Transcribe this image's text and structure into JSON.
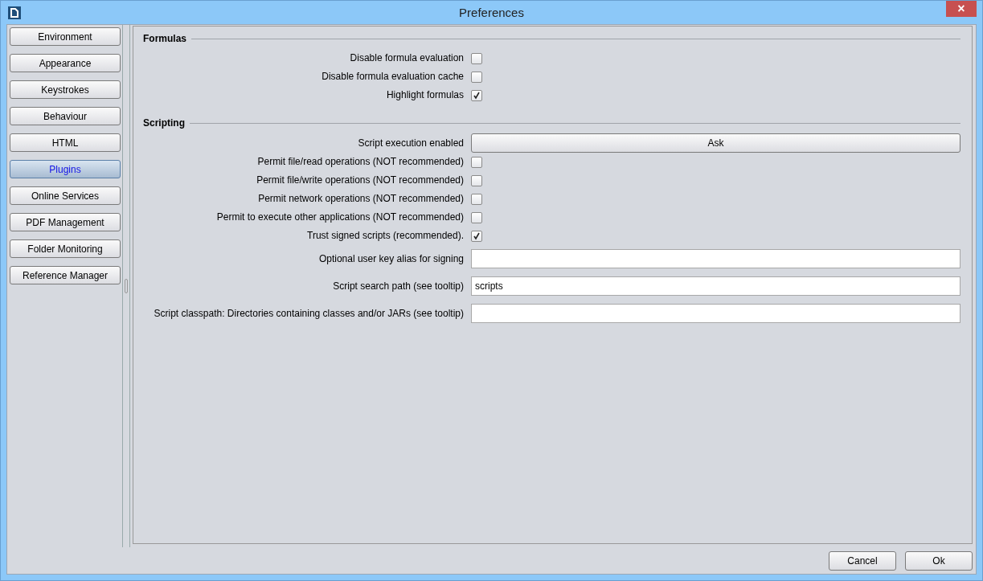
{
  "window": {
    "title": "Preferences",
    "close": "×"
  },
  "sidebar": {
    "items": [
      {
        "label": "Environment",
        "selected": false
      },
      {
        "label": "Appearance",
        "selected": false
      },
      {
        "label": "Keystrokes",
        "selected": false
      },
      {
        "label": "Behaviour",
        "selected": false
      },
      {
        "label": "HTML",
        "selected": false
      },
      {
        "label": "Plugins",
        "selected": true
      },
      {
        "label": "Online Services",
        "selected": false
      },
      {
        "label": "PDF Management",
        "selected": false
      },
      {
        "label": "Folder Monitoring",
        "selected": false
      },
      {
        "label": "Reference Manager",
        "selected": false
      }
    ]
  },
  "sections": [
    {
      "title": "Formulas",
      "rows": [
        {
          "kind": "checkbox",
          "label": "Disable formula evaluation",
          "checked": false
        },
        {
          "kind": "checkbox",
          "label": "Disable formula evaluation cache",
          "checked": false
        },
        {
          "kind": "checkbox",
          "label": "Highlight formulas",
          "checked": true
        }
      ]
    },
    {
      "title": "Scripting",
      "rows": [
        {
          "kind": "button",
          "label": "Script execution enabled",
          "value": "Ask"
        },
        {
          "kind": "checkbox",
          "label": "Permit file/read operations (NOT recommended)",
          "checked": false
        },
        {
          "kind": "checkbox",
          "label": "Permit file/write operations (NOT recommended)",
          "checked": false
        },
        {
          "kind": "checkbox",
          "label": "Permit network operations (NOT recommended)",
          "checked": false
        },
        {
          "kind": "checkbox",
          "label": "Permit to execute other applications (NOT recommended)",
          "checked": false
        },
        {
          "kind": "checkbox",
          "label": "Trust signed scripts (recommended).",
          "checked": true
        },
        {
          "kind": "field",
          "label": "Optional user key alias for signing"
        },
        {
          "kind": "field",
          "label": "Script search path (see tooltip)",
          "value": "scripts"
        },
        {
          "kind": "field",
          "label": "Script classpath: Directories containing classes and/or JARs (see tooltip)"
        }
      ]
    }
  ],
  "buttons": [
    "Cancel",
    "Ok"
  ]
}
